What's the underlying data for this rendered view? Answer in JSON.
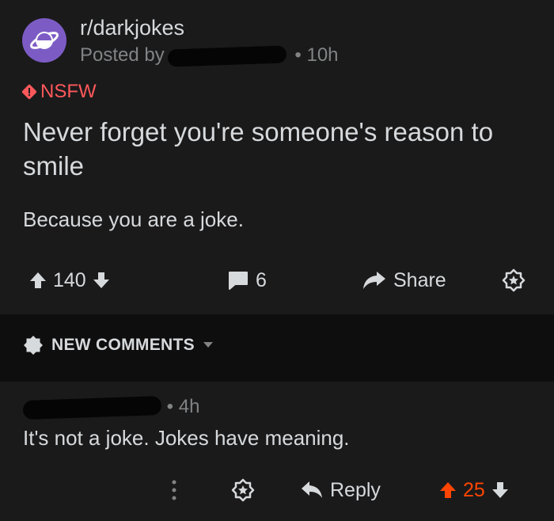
{
  "post": {
    "subreddit": "r/darkjokes",
    "posted_by_prefix": "Posted by",
    "time_sep": "•",
    "time": "10h",
    "nsfw_label": "NSFW",
    "title": "Never forget you're someone's reason to smile",
    "body": "Because you are a joke."
  },
  "actions": {
    "score": "140",
    "comments": "6",
    "share_label": "Share"
  },
  "sort": {
    "label": "NEW COMMENTS"
  },
  "comment": {
    "time_sep": "•",
    "time": "4h",
    "text": "It's not a joke. Jokes have meaning.",
    "reply_label": "Reply",
    "score": "25"
  },
  "colors": {
    "background": "#1a1a1b",
    "sort_bar": "#0e0e0f",
    "text": "#d7dadc",
    "meta": "#818384",
    "nsfw": "#ff585b",
    "upvote": "#ff4500",
    "avatar": "#7c5cc4"
  }
}
